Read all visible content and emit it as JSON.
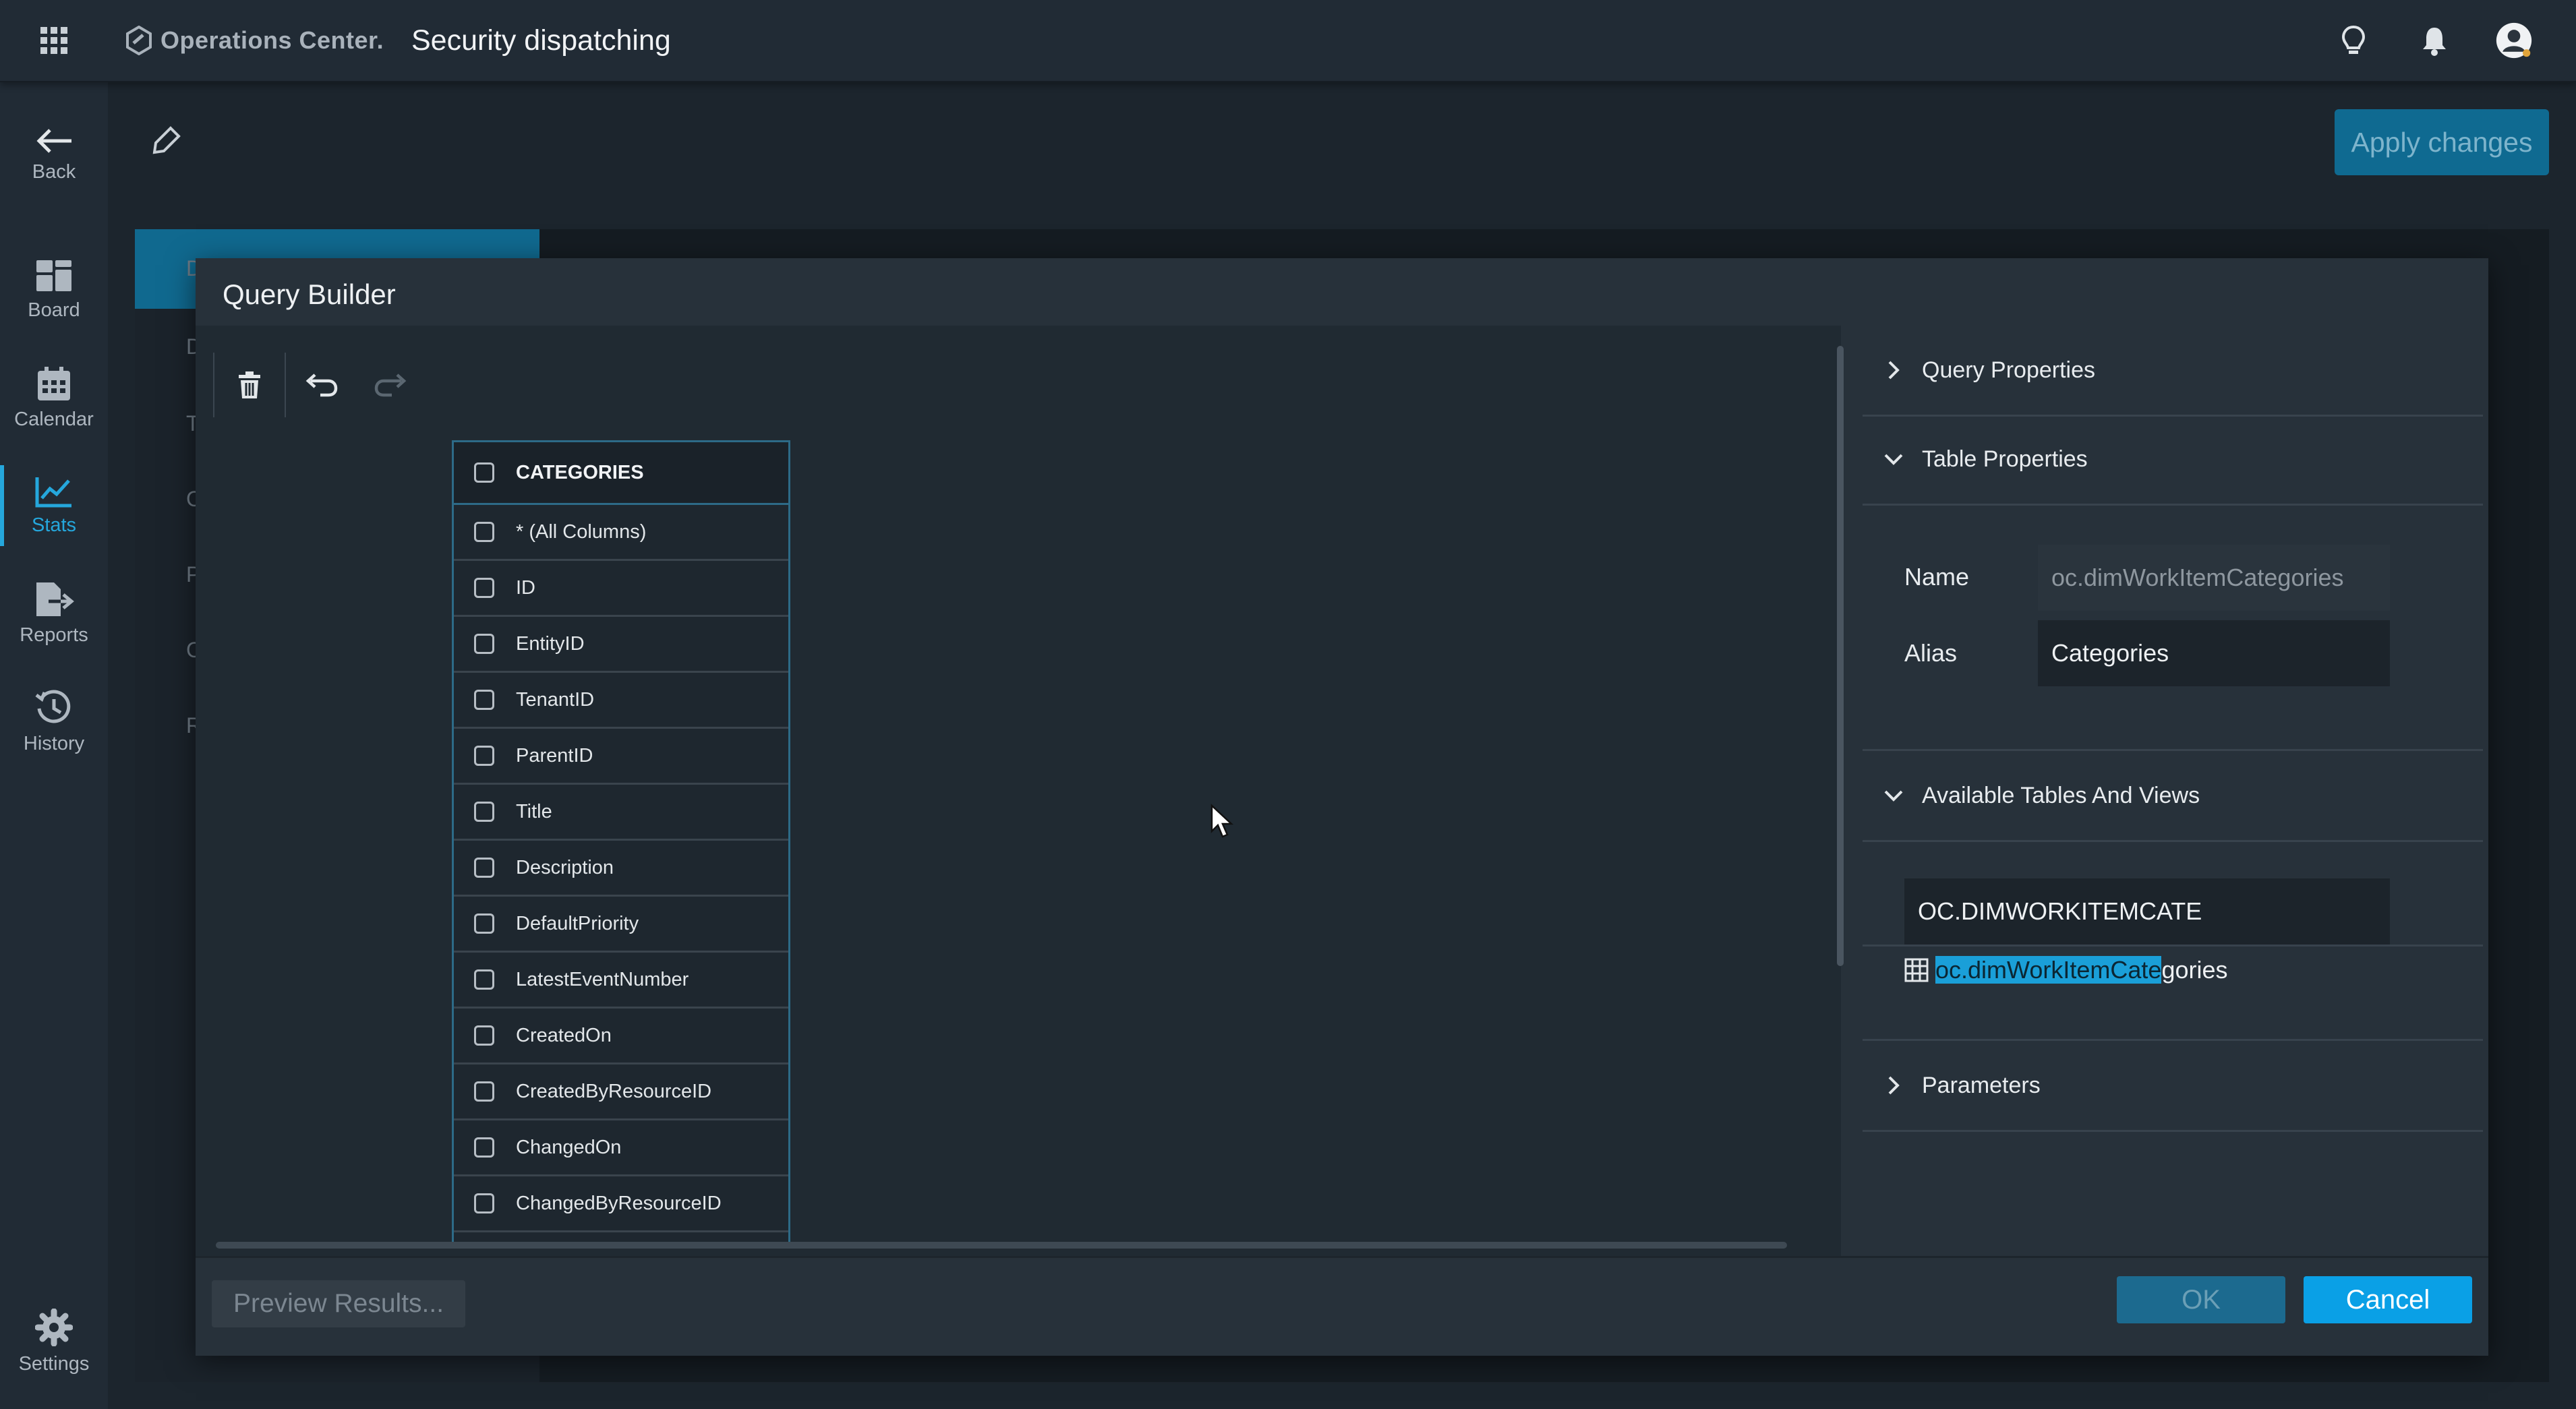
{
  "header": {
    "brand": "Operations Center.",
    "title": "Security dispatching"
  },
  "sidebar": {
    "items": [
      {
        "label": "Back",
        "icon": "arrow-left-icon"
      },
      {
        "label": "Board",
        "icon": "board-icon"
      },
      {
        "label": "Calendar",
        "icon": "calendar-icon"
      },
      {
        "label": "Stats",
        "icon": "chart-line-icon",
        "active": true
      },
      {
        "label": "Reports",
        "icon": "export-icon"
      },
      {
        "label": "History",
        "icon": "history-icon"
      },
      {
        "label": "Settings",
        "icon": "gear-icon"
      }
    ]
  },
  "main": {
    "apply_label": "Apply changes",
    "background_list_letters": [
      "D",
      "D",
      "T",
      "C",
      "P",
      "C",
      "R"
    ]
  },
  "dialog": {
    "title": "Query Builder",
    "table": {
      "name": "CATEGORIES",
      "columns": [
        "* (All Columns)",
        "ID",
        "EntityID",
        "TenantID",
        "ParentID",
        "Title",
        "Description",
        "DefaultPriority",
        "LatestEventNumber",
        "CreatedOn",
        "CreatedByResourceID",
        "ChangedOn",
        "ChangedByResourceID"
      ]
    },
    "right": {
      "query_properties": "Query Properties",
      "table_properties": "Table Properties",
      "name_label": "Name",
      "name_value": "oc.dimWorkItemCategories",
      "alias_label": "Alias",
      "alias_value": "Categories",
      "available": "Available Tables And Views",
      "search_value": "OC.DIMWORKITEMCATE",
      "result_match": "oc.dimWorkItemCate",
      "result_rest": "gories",
      "parameters": "Parameters"
    },
    "footer": {
      "preview": "Preview Results...",
      "ok": "OK",
      "cancel": "Cancel"
    }
  },
  "colors": {
    "accent": "#25a7dc",
    "primary_button": "#0aa0e6",
    "disabled_button": "#1c6a8f",
    "background": "#1f2933"
  }
}
